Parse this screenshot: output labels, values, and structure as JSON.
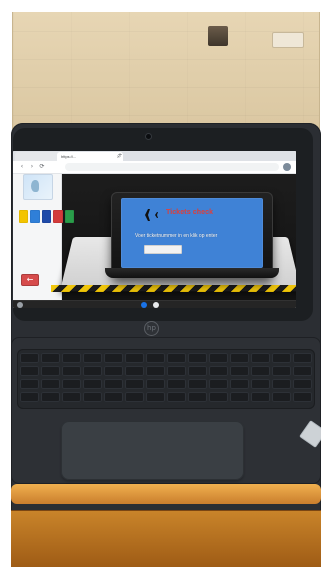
{
  "photo": {
    "browser": {
      "tabs": [
        {
          "label": ""
        },
        {
          "label": "https://..."
        }
      ],
      "omnibox": {
        "text": ""
      }
    },
    "web": {
      "screen_title": "Tickets check",
      "prompt": "Voer ticketnummer in en klik op enter",
      "footer_text": "",
      "footer_badge": "",
      "swatches": [
        "#f3c400",
        "#2f7fd8",
        "#1f4aa8",
        "#d33b3b",
        "#2a9d4a"
      ]
    },
    "colors": {
      "trim_orange": "#f0b04f",
      "desk_wood": "#c9842a",
      "laptop_gray": "#2b2e33",
      "screen_blue": "#3f82d6",
      "title_red": "#e04444"
    }
  }
}
